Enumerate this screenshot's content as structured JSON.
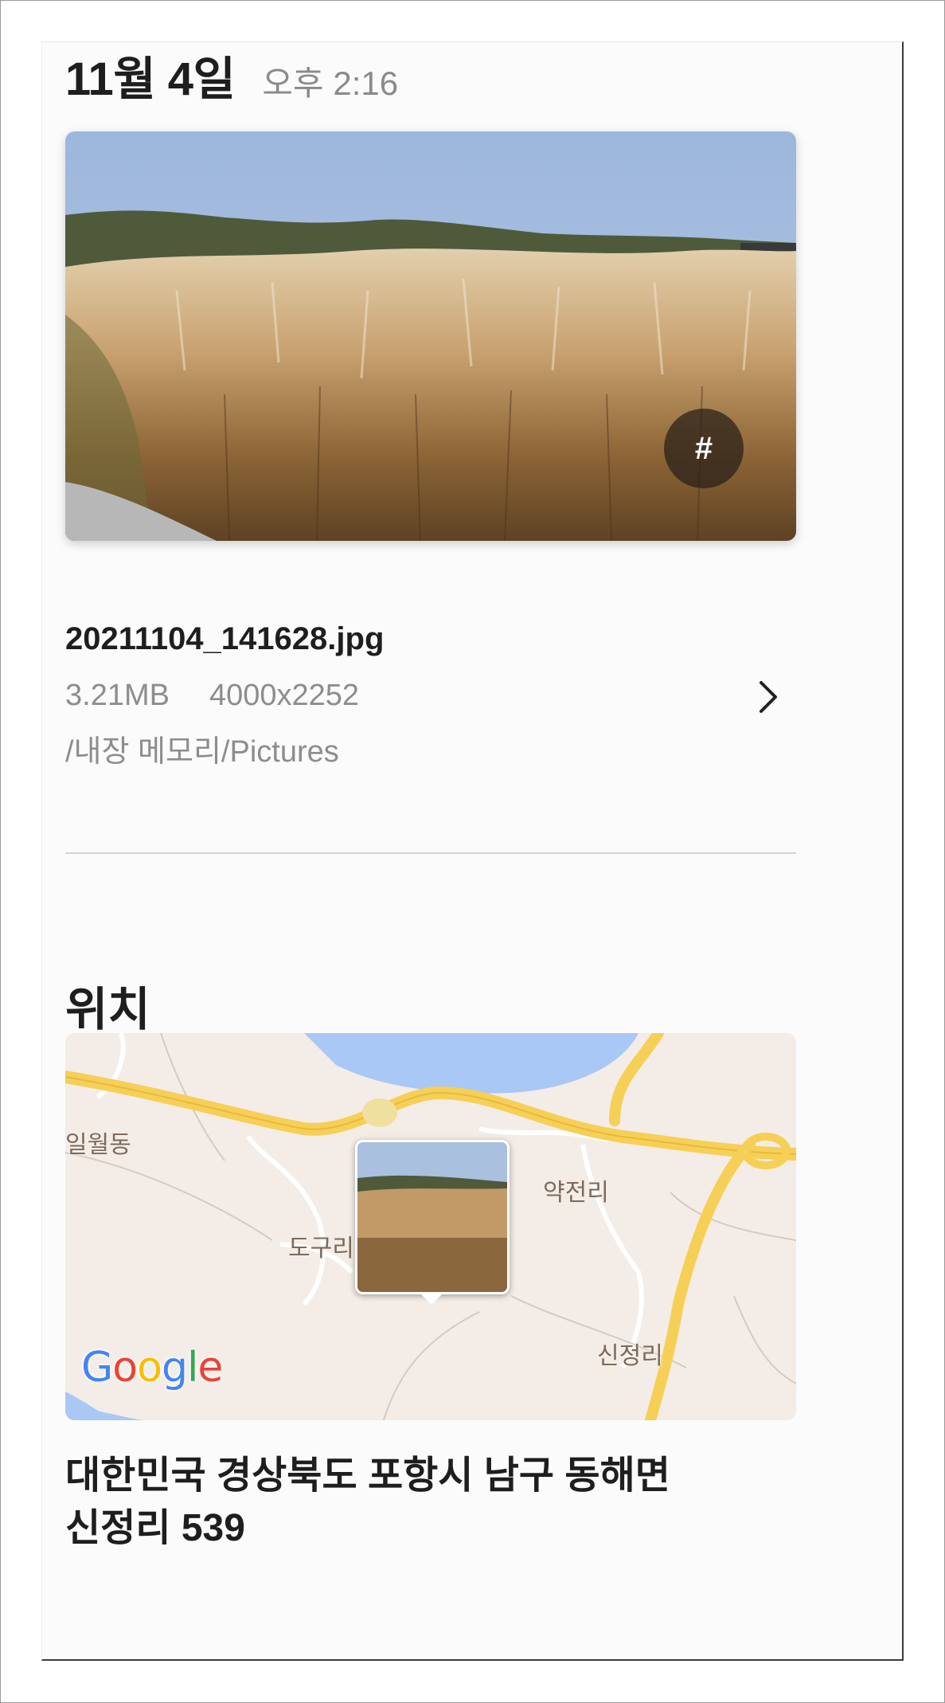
{
  "header": {
    "date": "11월 4일",
    "time": "오후 2:16"
  },
  "photo": {
    "tag_button_label": "#"
  },
  "file": {
    "name": "20211104_141628.jpg",
    "size": "3.21MB",
    "resolution": "4000x2252",
    "path": "/내장 메모리/Pictures"
  },
  "location": {
    "title": "위치",
    "map_labels": [
      "일월동",
      "약전리",
      "도구리",
      "신정리"
    ],
    "map_provider": "Google",
    "address_line1": "대한민국 경상북도 포항시 남구 동해면",
    "address_line2": "신정리 539"
  },
  "icons": {
    "chevron": "chevron-right-icon",
    "tag": "hashtag-icon"
  },
  "colors": {
    "text_primary": "#1e1e1e",
    "text_secondary": "#8d8d8d",
    "map_road": "#f6cf57",
    "map_water": "#a9c8f5",
    "map_land": "#f4ece6"
  }
}
